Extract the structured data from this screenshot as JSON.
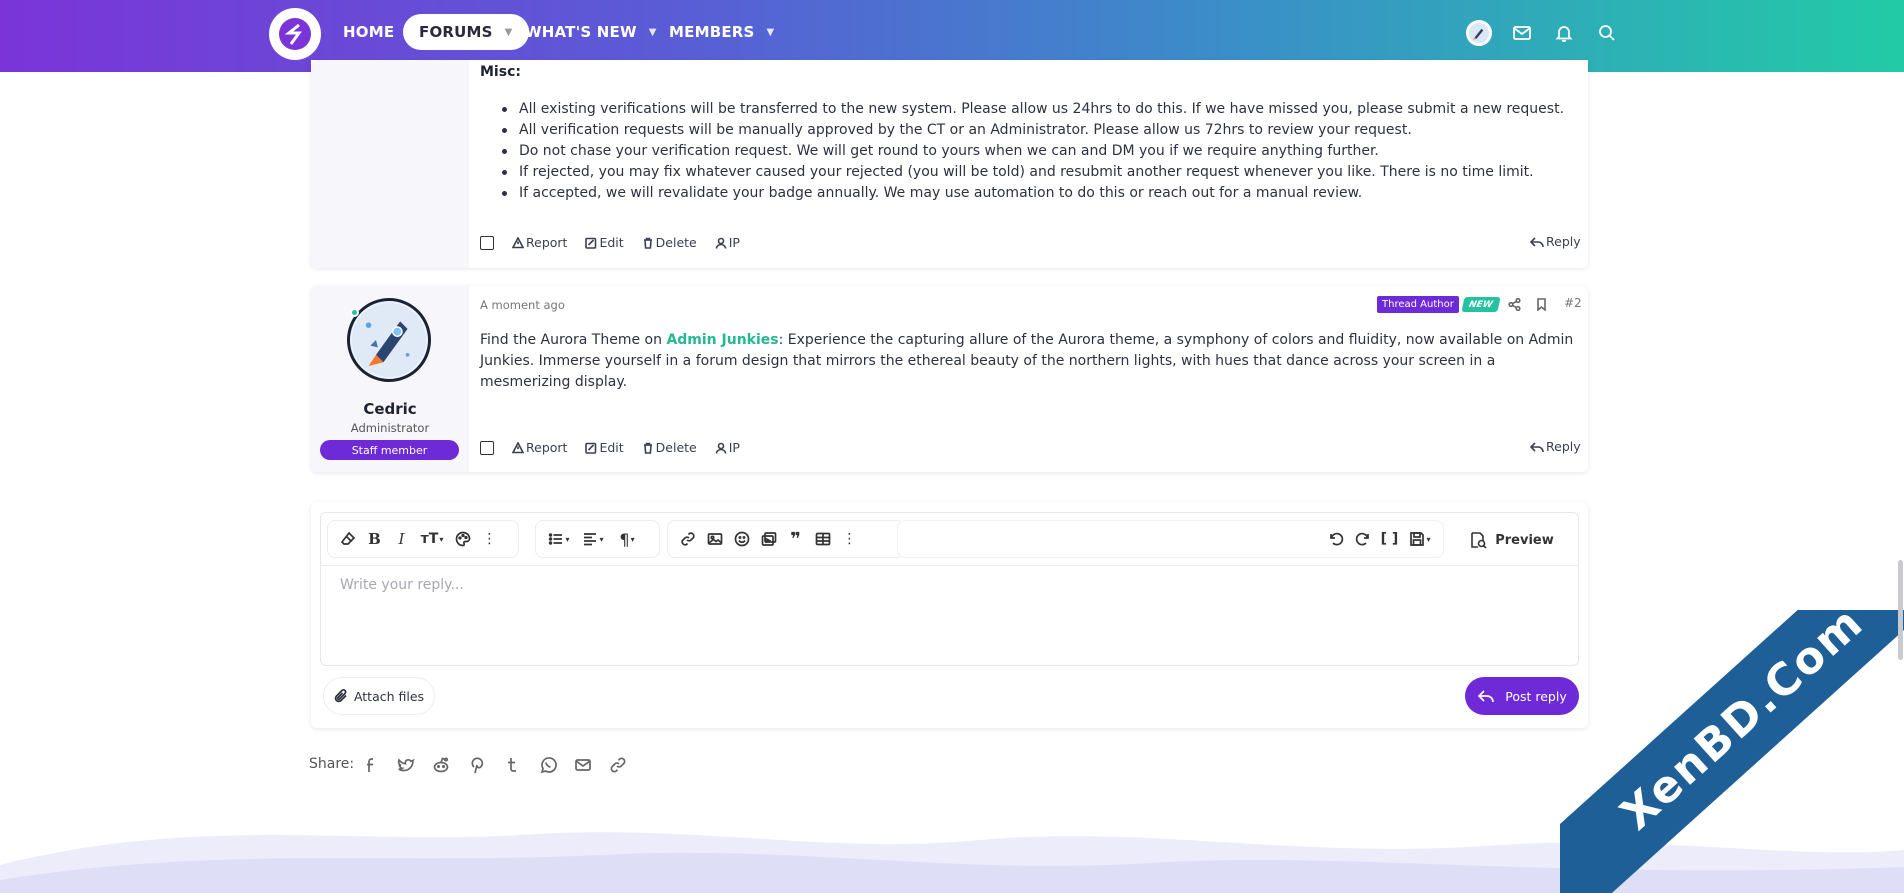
{
  "nav": {
    "home": "HOME",
    "forums": "FORUMS",
    "whats_new": "WHAT'S NEW",
    "members": "MEMBERS"
  },
  "post1": {
    "heading": "Misc:",
    "bullets": [
      "All existing verifications will be transferred to the new system. Please allow us 24hrs to do this. If we have missed you, please submit a new request.",
      "All verification requests will be manually approved by the CT or an Administrator. Please allow us 72hrs to review your request.",
      "Do not chase your verification request. We will get round to yours when we can and DM you if we require anything further.",
      "If rejected, you may fix whatever caused your rejected (you will be told) and resubmit another request whenever you like. There is no time limit.",
      "If accepted, we will revalidate your badge annually. We may use automation to do this or reach out for a manual review."
    ]
  },
  "actions": {
    "report": "Report",
    "edit": "Edit",
    "delete": "Delete",
    "ip": "IP",
    "reply": "Reply"
  },
  "post2": {
    "timestamp": "A moment ago",
    "thread_author": "Thread Author",
    "new_badge": "NEW",
    "number": "#2",
    "username": "Cedric",
    "user_title": "Administrator",
    "staff_banner": "Staff member",
    "text_before": "Find the Aurora Theme on ",
    "text_link": "Admin Junkies",
    "text_after": ": Experience the capturing allure of the Aurora theme, a symphony of colors and fluidity, now available on Admin Junkies. Immerse yourself in a forum design that mirrors the ethereal beauty of the northern lights, with hues that dance across your screen in a mesmerizing display."
  },
  "editor": {
    "placeholder": "Write your reply...",
    "preview": "Preview",
    "attach": "Attach files",
    "post_reply": "Post reply"
  },
  "share": {
    "label": "Share:"
  },
  "watermark": {
    "text": "XenBD.Com"
  },
  "colors": {
    "accent": "#6f2ad8",
    "green": "#25c2a0",
    "nav_start": "#7b34d8",
    "nav_end": "#22cba6"
  }
}
